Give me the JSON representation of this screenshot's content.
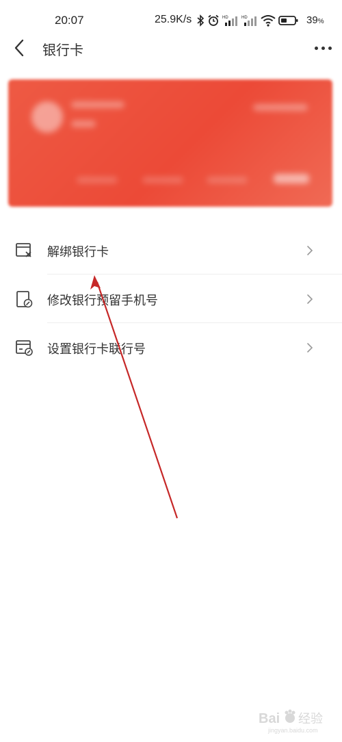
{
  "status_bar": {
    "time": "20:07",
    "net_speed": "25.9K/s",
    "battery_percent": "39",
    "battery_unit": "%",
    "icons": [
      "bluetooth-icon",
      "alarm-icon",
      "signal-hd-1-icon",
      "signal-hd-2-icon",
      "wifi-icon",
      "battery-icon"
    ]
  },
  "header": {
    "title": "银行卡",
    "back_icon": "chevron-left-icon",
    "more_icon": "more-horizontal-icon"
  },
  "card": {
    "state": "blurred"
  },
  "menu": {
    "items": [
      {
        "label": "解绑银行卡",
        "icon": "card-remove-icon"
      },
      {
        "label": "修改银行预留手机号",
        "icon": "phone-edit-icon"
      },
      {
        "label": "设置银行卡联行号",
        "icon": "card-edit-icon"
      }
    ]
  },
  "annotation": {
    "arrow_color": "#c62828"
  },
  "watermark": {
    "text": "Bai 经验",
    "sub": "jingyan.baidu.com"
  }
}
